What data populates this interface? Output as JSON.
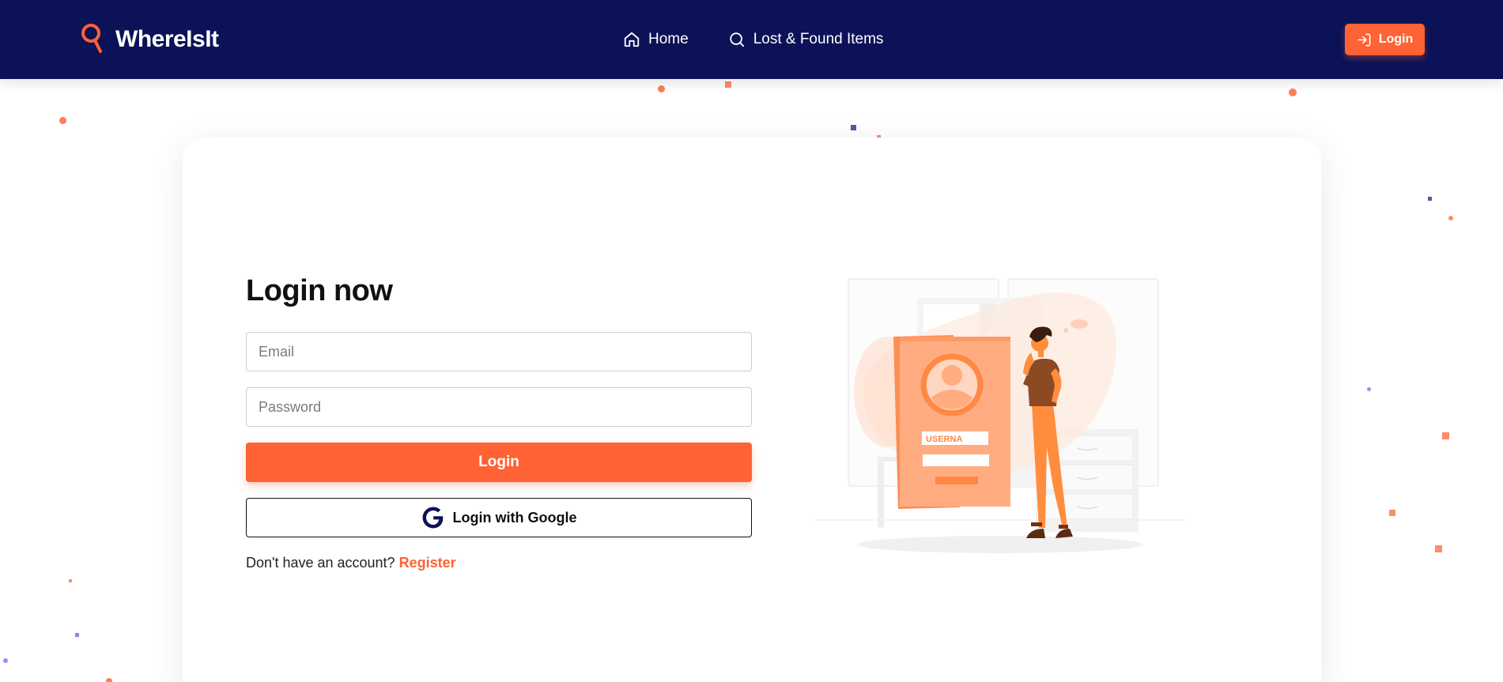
{
  "brand": {
    "name": "WhereIsIt",
    "icon": "search-icon"
  },
  "nav": {
    "items": [
      {
        "label": "Home",
        "icon": "home-icon"
      },
      {
        "label": "Lost & Found Items",
        "icon": "search-icon"
      }
    ]
  },
  "header": {
    "login_label": "Login",
    "login_icon": "sign-in-icon"
  },
  "login_form": {
    "title": "Login now",
    "email_placeholder": "Email",
    "email_value": "",
    "password_placeholder": "Password",
    "password_value": "",
    "login_button": "Login",
    "google_button": "Login with Google",
    "no_account_text": "Don't have an account?",
    "register_link": "Register"
  },
  "illustration": {
    "username_field_text": "USERNA",
    "description": "person-with-login-card-illustration"
  },
  "colors": {
    "navbar_bg": "#0b1257",
    "accent": "#ff6234",
    "google_icon": "#0b1257",
    "text": "#111111"
  }
}
